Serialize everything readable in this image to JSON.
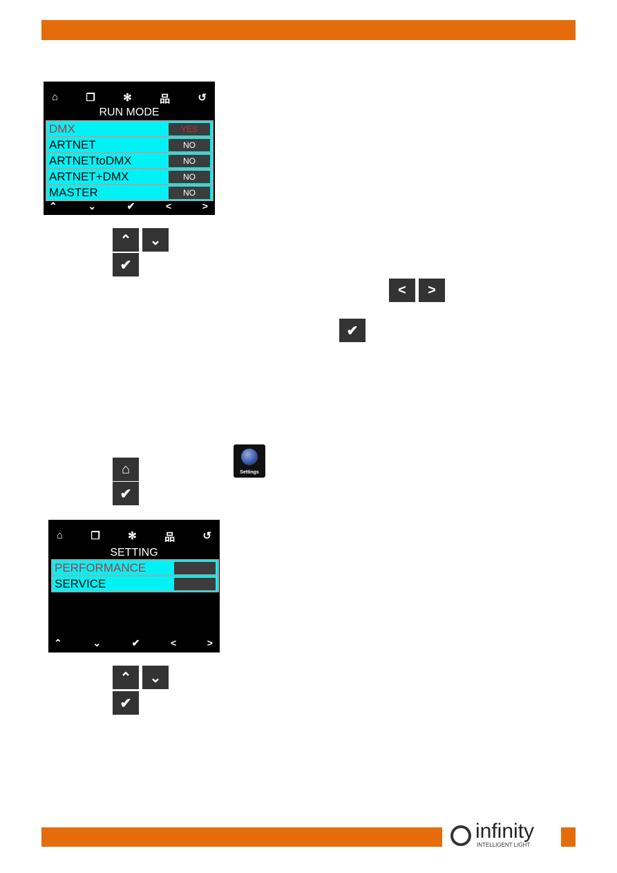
{
  "brand": {
    "accent": "#e46c0a",
    "logo_text": "infinity",
    "logo_subtext": "INTELLIGENT LIGHT"
  },
  "screen_icons": [
    "home-icon",
    "layers-icon",
    "asterisk-icon",
    "network-icon",
    "back-icon"
  ],
  "nav_icons": [
    "up-icon",
    "down-icon",
    "check-icon",
    "left-icon",
    "right-icon"
  ],
  "run_mode": {
    "title": "RUN MODE",
    "items": [
      {
        "label": "DMX",
        "value": "YES",
        "selected": true
      },
      {
        "label": "ARTNET",
        "value": "NO"
      },
      {
        "label": "ARTNETtoDMX",
        "value": "NO"
      },
      {
        "label": "ARTNET+DMX",
        "value": "NO"
      },
      {
        "label": "MASTER",
        "value": "NO"
      }
    ]
  },
  "setting": {
    "title": "SETTING",
    "items": [
      {
        "label": "PERFORMANCE",
        "value": "",
        "selected": true
      },
      {
        "label": "SERVICE",
        "value": ""
      }
    ]
  },
  "settings_icon_label": "Settings",
  "glyphs": {
    "up": "⌃",
    "down": "⌄",
    "check": "✔",
    "left": "<",
    "right": ">",
    "home": "⌂",
    "layers": "❐",
    "asterisk": "✻",
    "network": "品",
    "back": "↺"
  }
}
